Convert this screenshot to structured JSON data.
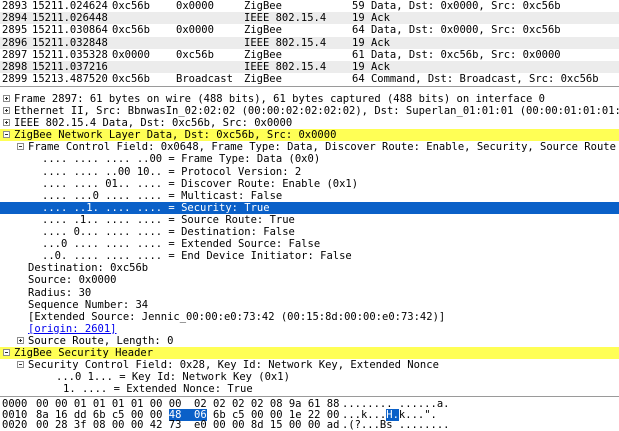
{
  "packets": [
    {
      "no": "2893",
      "time": "15211.024624",
      "src": "0xc56b",
      "dst": "0x0000",
      "proto": "ZigBee",
      "info": "59 Data, Dst: 0x0000, Src: 0xc56b"
    },
    {
      "no": "2894",
      "time": "15211.026448",
      "src": "",
      "dst": "",
      "proto": "IEEE 802.15.4",
      "info": "19 Ack"
    },
    {
      "no": "2895",
      "time": "15211.030864",
      "src": "0xc56b",
      "dst": "0x0000",
      "proto": "ZigBee",
      "info": "64 Data, Dst: 0x0000, Src: 0xc56b"
    },
    {
      "no": "2896",
      "time": "15211.032848",
      "src": "",
      "dst": "",
      "proto": "IEEE 802.15.4",
      "info": "19 Ack"
    },
    {
      "no": "2897",
      "time": "15211.035328",
      "src": "0x0000",
      "dst": "0xc56b",
      "proto": "ZigBee",
      "info": "61 Data, Dst: 0xc56b, Src: 0x0000"
    },
    {
      "no": "2898",
      "time": "15211.037216",
      "src": "",
      "dst": "",
      "proto": "IEEE 802.15.4",
      "info": "19 Ack"
    },
    {
      "no": "2899",
      "time": "15213.487520",
      "src": "0xc56b",
      "dst": "Broadcast",
      "proto": "ZigBee",
      "info": "64 Command, Dst: Broadcast, Src: 0xc56b"
    }
  ],
  "tree": {
    "frame": "Frame 2897: 61 bytes on wire (488 bits), 61 bytes captured (488 bits) on interface 0",
    "ethernet": "Ethernet II, Src: BbnwasIn_02:02:02 (00:00:02:02:02:02), Dst: Superlan_01:01:01 (00:00:01:01:01:01)",
    "ieee": "IEEE 802.15.4 Data, Dst: 0xc56b, Src: 0x0000",
    "zigbee_nwk": "ZigBee Network Layer Data, Dst: 0xc56b, Src: 0x0000",
    "fcf": "Frame Control Field: 0x0648, Frame Type: Data, Discover Route: Enable, Security, Source Route Data",
    "fcf_bits": [
      ".... .... .... ..00 = Frame Type: Data (0x0)",
      ".... .... ..00 10.. = Protocol Version: 2",
      ".... .... 01.. .... = Discover Route: Enable (0x1)",
      ".... ...0 .... .... = Multicast: False",
      ".... ..1. .... .... = Security: True",
      ".... .1.. .... .... = Source Route: True",
      ".... 0... .... .... = Destination: False",
      "...0 .... .... .... = Extended Source: False",
      "..0. .... .... .... = End Device Initiator: False"
    ],
    "destination": "Destination: 0xc56b",
    "source": "Source: 0x0000",
    "radius": "Radius: 30",
    "sequence": "Sequence Number: 34",
    "ext_source": "[Extended Source: Jennic_00:00:e0:73:42 (00:15:8d:00:00:e0:73:42)]",
    "origin": "[origin: 2601]",
    "source_route": "Source Route, Length: 0",
    "zigbee_sec": "ZigBee Security Header",
    "scf": "Security Control Field: 0x28, Key Id: Network Key, Extended Nonce",
    "key_id": "...0 1... = Key Id: Network Key (0x1)",
    "ext_nonce": "1. .... = Extended Nonce: True"
  },
  "hex": [
    {
      "off": "0000",
      "b1": "00 00 01 01 01 01 00 00  02 02 02 02 08 9a 61 88",
      "a1": "........ ......a."
    },
    {
      "off": "0010",
      "b1": "8a 16 dd 6b c5 00 00 ",
      "hb": "48  06",
      "b2": " 6b c5 00 00 1e 22 00",
      "a1": "...k...",
      "ha": "H.",
      "a2": "k...\"."
    },
    {
      "off": "0020",
      "b1": "00 28 3f 08 00 00 42 73  e0 00 00 8d 15 00 00 ad",
      "a1": ".(?...Bs ........"
    }
  ]
}
